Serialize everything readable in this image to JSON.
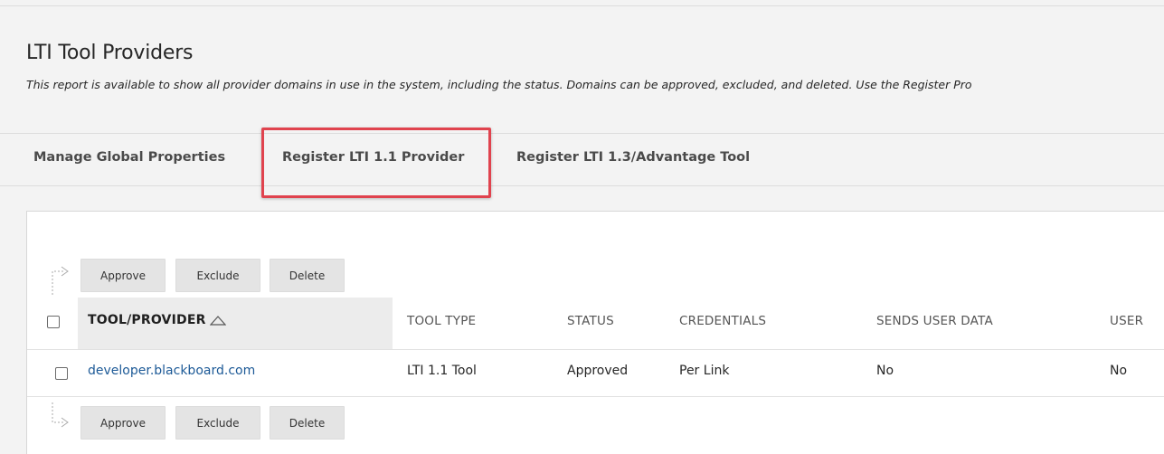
{
  "page": {
    "title": "LTI Tool Providers",
    "description": "This report is available to show all provider domains in use in the system, including the status. Domains can be approved, excluded, and deleted. Use the Register Pro"
  },
  "tabs": [
    {
      "label": "Manage Global Properties"
    },
    {
      "label": "Register LTI 1.1 Provider",
      "highlighted": true
    },
    {
      "label": "Register LTI 1.3/Advantage Tool"
    }
  ],
  "actions": {
    "approve": "Approve",
    "exclude": "Exclude",
    "delete": "Delete"
  },
  "table": {
    "columns": [
      "TOOL/PROVIDER",
      "TOOL TYPE",
      "STATUS",
      "CREDENTIALS",
      "SENDS USER DATA",
      "USER"
    ],
    "sorted_column": "TOOL/PROVIDER",
    "sort_direction": "ascending",
    "rows": [
      {
        "tool_provider": "developer.blackboard.com",
        "tool_type": "LTI 1.1 Tool",
        "status": "Approved",
        "credentials": "Per Link",
        "sends_user_data": "No",
        "user": "No"
      }
    ]
  },
  "colors": {
    "highlight_border": "#e0434e",
    "link": "#1d5a97",
    "page_background": "#f3f3f3"
  }
}
